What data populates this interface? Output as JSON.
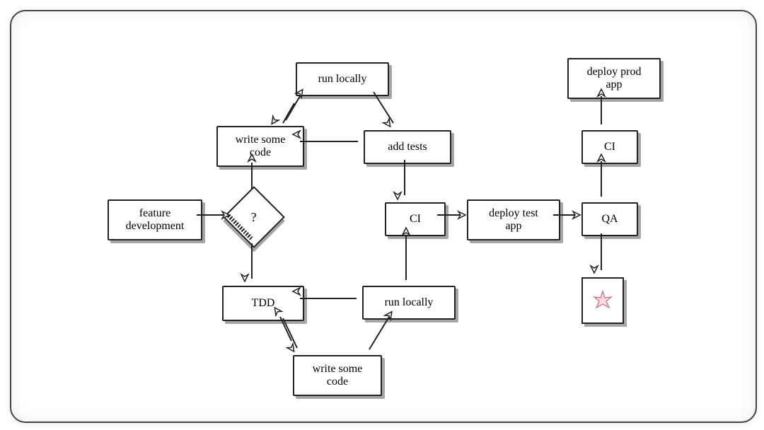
{
  "diagram": {
    "type": "flowchart",
    "style": "hand-drawn",
    "nodes": {
      "feature_dev": {
        "label": "feature\ndevelopment",
        "shape": "rect"
      },
      "decision": {
        "label": "?",
        "shape": "diamond"
      },
      "write_code_top": {
        "label": "write some\ncode",
        "shape": "rect"
      },
      "run_local_top": {
        "label": "run locally",
        "shape": "rect"
      },
      "add_tests": {
        "label": "add tests",
        "shape": "rect"
      },
      "ci_mid": {
        "label": "CI",
        "shape": "rect"
      },
      "run_local_bot": {
        "label": "run locally",
        "shape": "rect"
      },
      "write_code_bot": {
        "label": "write some\ncode",
        "shape": "rect"
      },
      "tdd": {
        "label": "TDD",
        "shape": "rect"
      },
      "deploy_test": {
        "label": "deploy test\napp",
        "shape": "rect"
      },
      "qa": {
        "label": "QA",
        "shape": "rect"
      },
      "ci_right": {
        "label": "CI",
        "shape": "rect"
      },
      "deploy_prod": {
        "label": "deploy prod\napp",
        "shape": "rect"
      },
      "bug": {
        "label": "★",
        "shape": "rect",
        "icon": "star-icon"
      }
    },
    "edges": [
      {
        "from": "feature_dev",
        "to": "decision",
        "dir": "right"
      },
      {
        "from": "decision",
        "to": "write_code_top",
        "dir": "up"
      },
      {
        "from": "write_code_top",
        "to": "run_local_top",
        "dir": "bidirectional"
      },
      {
        "from": "run_local_top",
        "to": "add_tests",
        "dir": "down-right"
      },
      {
        "from": "add_tests",
        "to": "write_code_top",
        "dir": "left"
      },
      {
        "from": "add_tests",
        "to": "ci_mid",
        "dir": "down"
      },
      {
        "from": "ci_mid",
        "to": "deploy_test",
        "dir": "right"
      },
      {
        "from": "decision",
        "to": "tdd",
        "dir": "down"
      },
      {
        "from": "tdd",
        "to": "write_code_bot",
        "dir": "bidirectional"
      },
      {
        "from": "write_code_bot",
        "to": "run_local_bot",
        "dir": "up-right"
      },
      {
        "from": "run_local_bot",
        "to": "tdd",
        "dir": "left"
      },
      {
        "from": "run_local_bot",
        "to": "ci_mid",
        "dir": "up"
      },
      {
        "from": "deploy_test",
        "to": "qa",
        "dir": "right"
      },
      {
        "from": "qa",
        "to": "ci_right",
        "dir": "up"
      },
      {
        "from": "ci_right",
        "to": "deploy_prod",
        "dir": "up"
      },
      {
        "from": "qa",
        "to": "bug",
        "dir": "down"
      }
    ]
  }
}
